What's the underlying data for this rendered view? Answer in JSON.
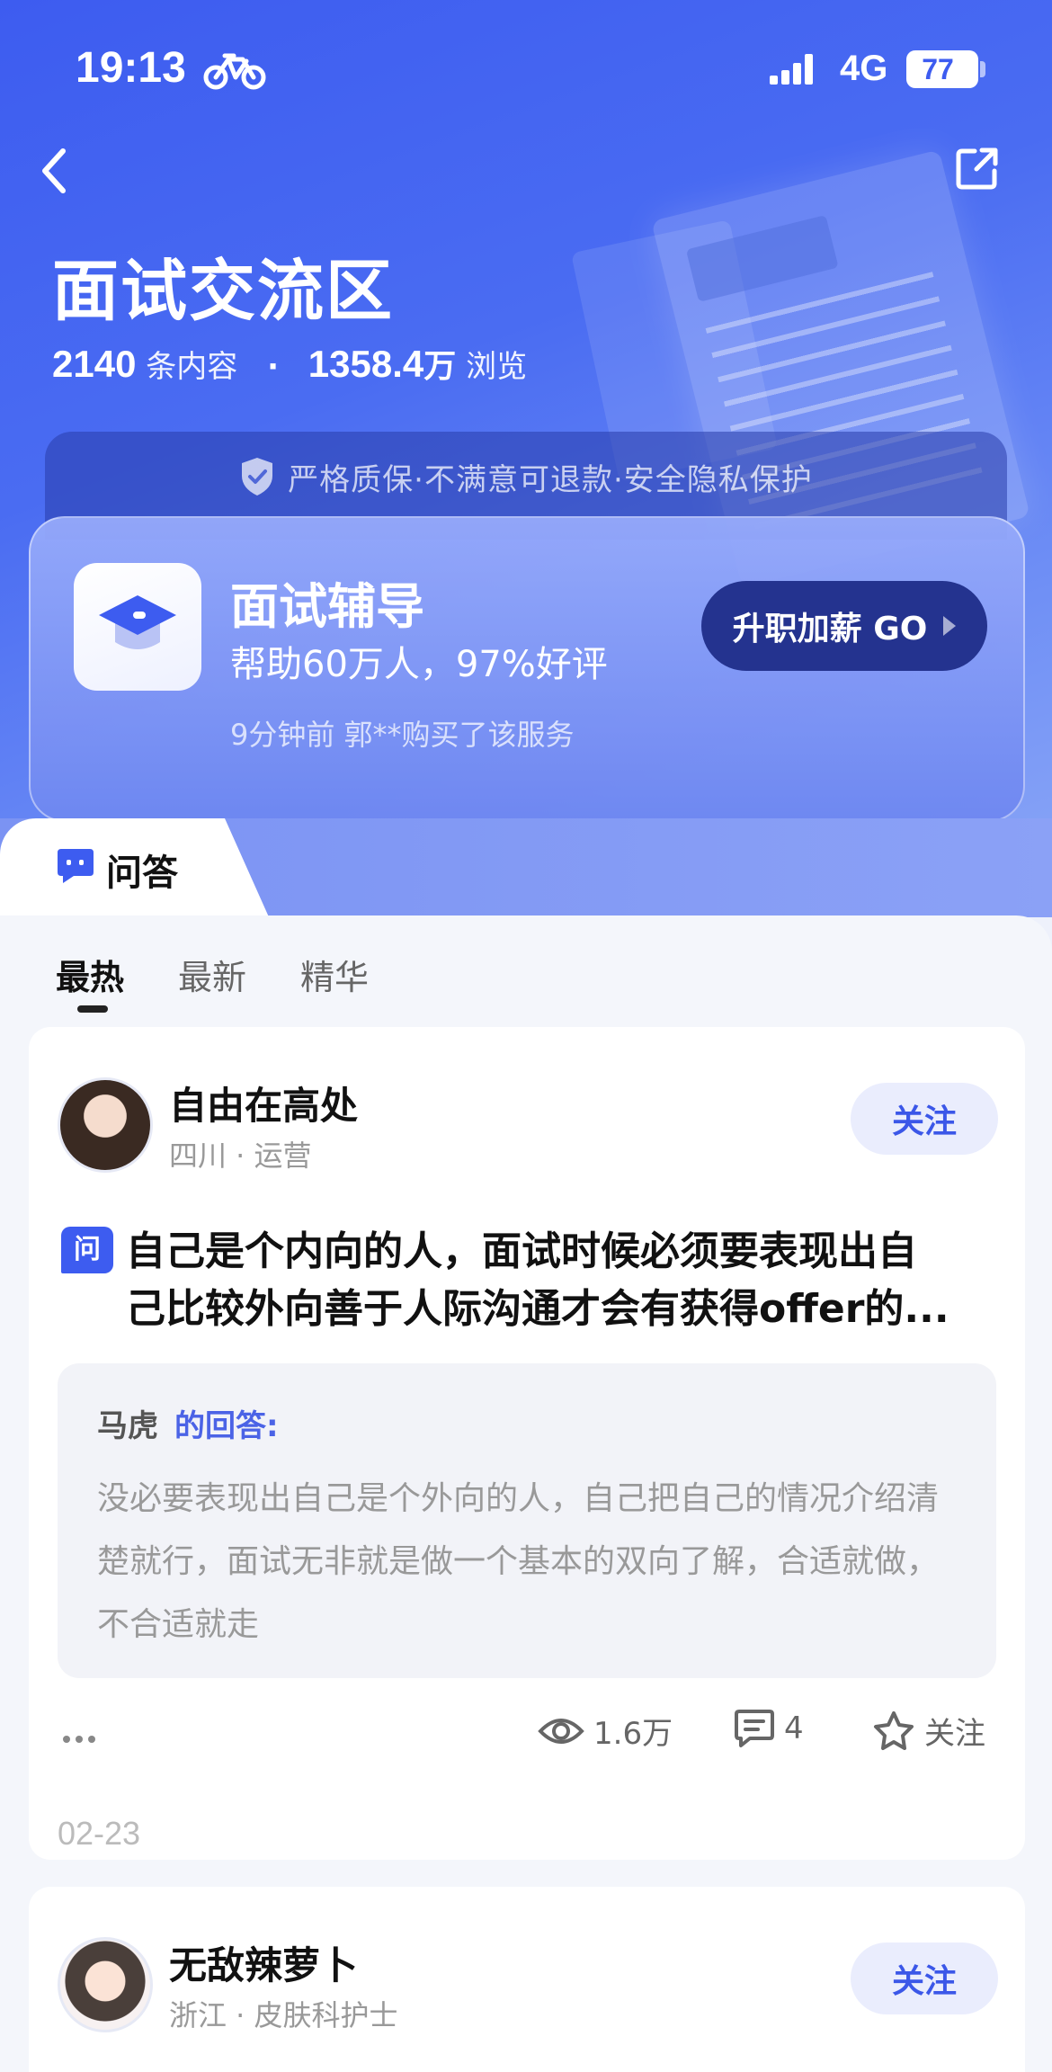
{
  "status_bar": {
    "time": "19:13",
    "network": "4G",
    "battery": "77",
    "battery_level": 0.77
  },
  "header": {
    "title": "面试交流区",
    "content_count": "2140",
    "content_label": "条内容",
    "separator": "·",
    "views": "1358.4",
    "views_unit": "万",
    "views_label": "浏览",
    "guarantee": "严格质保·不满意可退款·安全隐私保护"
  },
  "service": {
    "title": "面试辅导",
    "subtitle": "帮助60万人，97%好评",
    "recent": "9分钟前 郭**购买了该服务",
    "button": "升职加薪 GO"
  },
  "section_tab": {
    "label": "问答"
  },
  "sort_tabs": [
    "最热",
    "最新",
    "精华"
  ],
  "posts": [
    {
      "author": "自由在高处",
      "meta": "四川 · 运营",
      "follow": "关注",
      "q_badge": "问",
      "question_line1": "自己是个内向的人，面试时候必须要表现出自",
      "question_line2": "己比较外向善于人际沟通才会有获得offer的...",
      "answerer": "马虎",
      "answer_suffix": "的回答:",
      "answer": "没必要表现出自己是个外向的人，自己把自己的情况介绍清楚就行，面试无非就是做一个基本的双向了解，合适就做，不合适就走",
      "views": "1.6万",
      "comments": "4",
      "favorite": "关注",
      "date": "02-23"
    },
    {
      "author": "无敌辣萝卜",
      "meta": "浙江 · 皮肤科护士",
      "follow": "关注"
    }
  ]
}
